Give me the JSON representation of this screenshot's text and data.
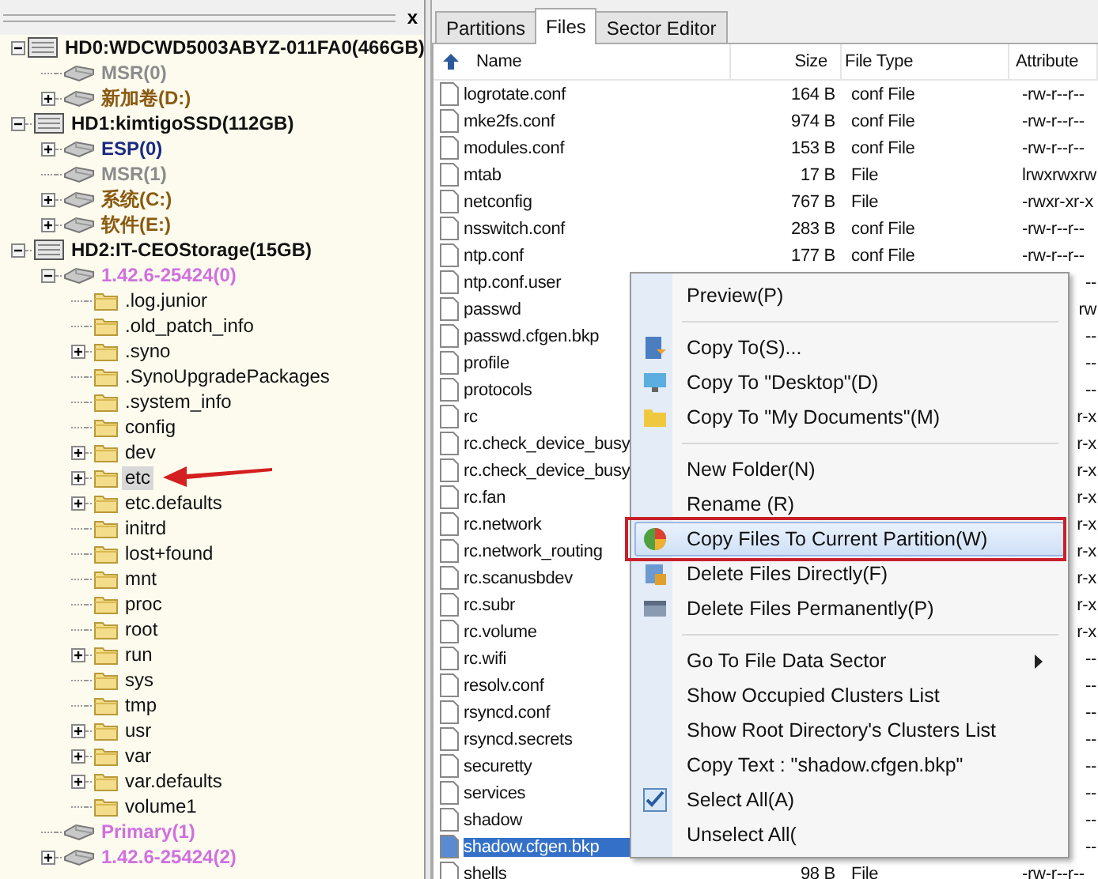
{
  "left_pane": {
    "close": "x"
  },
  "tree": {
    "nodes": [
      {
        "label": "HD0:WDCWD5003ABYZ-011FA0(466GB)",
        "kind": "disk",
        "expanded": true,
        "selected": false,
        "children": [
          {
            "label": "MSR(0)",
            "kind": "partition",
            "color": "#8c8c8c",
            "selected": false
          },
          {
            "label": "新加卷(D:)",
            "kind": "partition",
            "color": "#8a5a10",
            "expanded": false,
            "selected": false
          }
        ]
      },
      {
        "label": "HD1:kimtigoSSD(112GB)",
        "kind": "disk",
        "expanded": true,
        "selected": false,
        "children": [
          {
            "label": "ESP(0)",
            "kind": "partition",
            "color": "#1a2a80",
            "expanded": false,
            "selected": false
          },
          {
            "label": "MSR(1)",
            "kind": "partition",
            "color": "#8c8c8c",
            "selected": false
          },
          {
            "label": "系统(C:)",
            "kind": "partition",
            "color": "#8a5a10",
            "expanded": false,
            "selected": false
          },
          {
            "label": "软件(E:)",
            "kind": "partition",
            "color": "#8a5a10",
            "expanded": false,
            "selected": false
          }
        ]
      },
      {
        "label": "HD2:IT-CEOStorage(15GB)",
        "kind": "disk",
        "expanded": true,
        "selected": false,
        "children": [
          {
            "label": "1.42.6-25424(0)",
            "kind": "partition",
            "color": "#d070e0",
            "expanded": true,
            "selected": false,
            "children": [
              {
                "label": ".log.junior",
                "kind": "folder",
                "selected": false
              },
              {
                "label": ".old_patch_info",
                "kind": "folder",
                "selected": false
              },
              {
                "label": ".syno",
                "kind": "folder",
                "expanded": false,
                "selected": false
              },
              {
                "label": ".SynoUpgradePackages",
                "kind": "folder",
                "selected": false
              },
              {
                "label": ".system_info",
                "kind": "folder",
                "selected": false
              },
              {
                "label": "config",
                "kind": "folder",
                "selected": false
              },
              {
                "label": "dev",
                "kind": "folder",
                "expanded": false,
                "selected": false
              },
              {
                "label": "etc",
                "kind": "folder",
                "expanded": false,
                "selected": true,
                "annotated": true
              },
              {
                "label": "etc.defaults",
                "kind": "folder",
                "expanded": false,
                "selected": false
              },
              {
                "label": "initrd",
                "kind": "folder",
                "selected": false
              },
              {
                "label": "lost+found",
                "kind": "folder",
                "selected": false
              },
              {
                "label": "mnt",
                "kind": "folder",
                "selected": false
              },
              {
                "label": "proc",
                "kind": "folder",
                "selected": false
              },
              {
                "label": "root",
                "kind": "folder",
                "selected": false
              },
              {
                "label": "run",
                "kind": "folder",
                "expanded": false,
                "selected": false
              },
              {
                "label": "sys",
                "kind": "folder",
                "selected": false
              },
              {
                "label": "tmp",
                "kind": "folder",
                "selected": false
              },
              {
                "label": "usr",
                "kind": "folder",
                "expanded": false,
                "selected": false
              },
              {
                "label": "var",
                "kind": "folder",
                "expanded": false,
                "selected": false
              },
              {
                "label": "var.defaults",
                "kind": "folder",
                "expanded": false,
                "selected": false
              },
              {
                "label": "volume1",
                "kind": "folder",
                "selected": false
              }
            ]
          },
          {
            "label": "Primary(1)",
            "kind": "partition",
            "color": "#d070e0",
            "selected": false
          },
          {
            "label": "1.42.6-25424(2)",
            "kind": "partition",
            "color": "#d070e0",
            "expanded": false,
            "selected": false
          }
        ]
      }
    ]
  },
  "tabs": [
    {
      "label": "Partitions",
      "selected": false
    },
    {
      "label": "Files",
      "selected": true
    },
    {
      "label": "Sector Editor",
      "selected": false
    }
  ],
  "table": {
    "columns": [
      "Name",
      "Size",
      "File Type",
      "Attribute"
    ],
    "rows": [
      {
        "kind": "full",
        "name": "logrotate.conf",
        "size": "164 B",
        "type": "conf File",
        "attribute": "-rw-r--r--",
        "selected": false
      },
      {
        "kind": "full",
        "name": "mke2fs.conf",
        "size": "974 B",
        "type": "conf File",
        "attribute": "-rw-r--r--",
        "selected": false
      },
      {
        "kind": "full",
        "name": "modules.conf",
        "size": "153 B",
        "type": "conf File",
        "attribute": "-rw-r--r--",
        "selected": false
      },
      {
        "kind": "full",
        "name": "mtab",
        "size": "17 B",
        "type": "File",
        "attribute": "lrwxrwxrw",
        "selected": false
      },
      {
        "kind": "full",
        "name": "netconfig",
        "size": "767 B",
        "type": "File",
        "attribute": "-rwxr-xr-x",
        "selected": false
      },
      {
        "kind": "full",
        "name": "nsswitch.conf",
        "size": "283 B",
        "type": "conf File",
        "attribute": "-rw-r--r--",
        "selected": false
      },
      {
        "kind": "full",
        "name": "ntp.conf",
        "size": "177 B",
        "type": "conf File",
        "attribute": "-rw-r--r--",
        "selected": false
      },
      {
        "kind": "covered",
        "name": "ntp.conf.user",
        "attribute": "--",
        "selected": false
      },
      {
        "kind": "covered",
        "name": "passwd",
        "attribute": "rw",
        "selected": false
      },
      {
        "kind": "covered",
        "name": "passwd.cfgen.bkp",
        "attribute": "--",
        "selected": false
      },
      {
        "kind": "covered",
        "name": "profile",
        "attribute": "--",
        "selected": false
      },
      {
        "kind": "covered",
        "name": "protocols",
        "attribute": "--",
        "selected": false
      },
      {
        "kind": "covered",
        "name": "rc",
        "attribute": "r-x",
        "selected": false
      },
      {
        "kind": "covered",
        "name": "rc.check_device_busy",
        "attribute": "r-x",
        "selected": false
      },
      {
        "kind": "covered",
        "name": "rc.check_device_busy",
        "attribute": "r-x",
        "selected": false
      },
      {
        "kind": "covered",
        "name": "rc.fan",
        "attribute": "r-x",
        "selected": false
      },
      {
        "kind": "covered",
        "name": "rc.network",
        "attribute": "r-x",
        "selected": false
      },
      {
        "kind": "covered",
        "name": "rc.network_routing",
        "attribute": "r-x",
        "selected": false
      },
      {
        "kind": "covered",
        "name": "rc.scanusbdev",
        "attribute": "r-x",
        "selected": false
      },
      {
        "kind": "covered",
        "name": "rc.subr",
        "attribute": "r-x",
        "selected": false
      },
      {
        "kind": "covered",
        "name": "rc.volume",
        "attribute": "r-x",
        "selected": false
      },
      {
        "kind": "covered",
        "name": "rc.wifi",
        "attribute": "--",
        "selected": false
      },
      {
        "kind": "covered",
        "name": "resolv.conf",
        "attribute": "--",
        "selected": false
      },
      {
        "kind": "covered",
        "name": "rsyncd.conf",
        "attribute": "--",
        "selected": false
      },
      {
        "kind": "covered",
        "name": "rsyncd.secrets",
        "attribute": "--",
        "selected": false
      },
      {
        "kind": "covered",
        "name": "securetty",
        "attribute": "--",
        "selected": false
      },
      {
        "kind": "covered",
        "name": "services",
        "attribute": "--",
        "selected": false
      },
      {
        "kind": "covered",
        "name": "shadow",
        "attribute": "--",
        "selected": false
      },
      {
        "kind": "covered",
        "name": "shadow.cfgen.bkp",
        "attribute": "--",
        "selected": true
      },
      {
        "kind": "full",
        "name": "shells",
        "size": "98 B",
        "type": "File",
        "attribute": "-rw-r--r--",
        "selected": false
      }
    ]
  },
  "context_menu": {
    "items": [
      {
        "kind": "plain",
        "label": "Preview(P)",
        "submenu": false,
        "highlighted": false
      },
      {
        "kind": "separator"
      },
      {
        "kind": "copy",
        "label": "Copy To(S)...",
        "submenu": false,
        "highlighted": false
      },
      {
        "kind": "desktop",
        "label": "Copy To \"Desktop\"(D)",
        "submenu": false,
        "highlighted": false
      },
      {
        "kind": "folder",
        "label": "Copy To \"My Documents\"(M)",
        "submenu": false,
        "highlighted": false
      },
      {
        "kind": "separator"
      },
      {
        "kind": "plain",
        "label": "New Folder(N)",
        "submenu": false,
        "highlighted": false
      },
      {
        "kind": "plain",
        "label": "Rename (R)",
        "submenu": false,
        "highlighted": false
      },
      {
        "kind": "pie",
        "label": "Copy Files To Current Partition(W)",
        "submenu": false,
        "highlighted": true,
        "annotated": true
      },
      {
        "kind": "delete",
        "label": "Delete Files Directly(F)",
        "submenu": false,
        "highlighted": false
      },
      {
        "kind": "erase",
        "label": "Delete Files Permanently(P)",
        "submenu": false,
        "highlighted": false
      },
      {
        "kind": "separator"
      },
      {
        "kind": "plain",
        "label": "Go To File Data Sector",
        "submenu": true,
        "highlighted": false
      },
      {
        "kind": "plain",
        "label": "Show Occupied Clusters List",
        "submenu": false,
        "highlighted": false
      },
      {
        "kind": "plain",
        "label": "Show Root Directory's Clusters List",
        "submenu": false,
        "highlighted": false
      },
      {
        "kind": "plain",
        "label": "Copy Text : \"shadow.cfgen.bkp\"",
        "submenu": false,
        "highlighted": false
      },
      {
        "kind": "check",
        "label": "Select All(A)",
        "submenu": false,
        "highlighted": false
      },
      {
        "kind": "plain",
        "label": "Unselect All(",
        "submenu": false,
        "highlighted": false
      }
    ]
  }
}
